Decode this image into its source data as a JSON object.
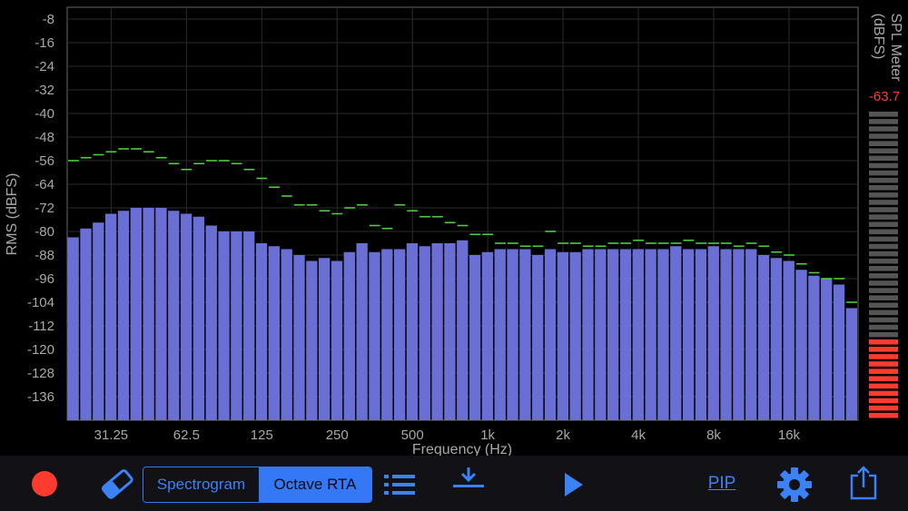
{
  "chart_data": {
    "type": "bar",
    "ylabel": "RMS (dBFS)",
    "xlabel": "Frequency (Hz)",
    "y_ticks": [
      "-8",
      "-16",
      "-24",
      "-32",
      "-40",
      "-48",
      "-56",
      "-64",
      "-72",
      "-80",
      "-88",
      "-96",
      "-104",
      "-112",
      "-120",
      "-128",
      "-136"
    ],
    "y_tick_values": [
      -8,
      -16,
      -24,
      -32,
      -40,
      -48,
      -56,
      -64,
      -72,
      -80,
      -88,
      -96,
      -104,
      -112,
      -120,
      -128,
      -136
    ],
    "x_ticks": [
      "31.25",
      "62.5",
      "125",
      "250",
      "500",
      "1k",
      "2k",
      "4k",
      "8k",
      "16k"
    ],
    "ylim": [
      -144,
      -4
    ],
    "grid": true,
    "series": [
      {
        "type": "bar",
        "color": "#6a6fd6",
        "values": [
          -82,
          -79,
          -77,
          -74,
          -73,
          -72,
          -72,
          -72,
          -73,
          -74,
          -75,
          -78,
          -80,
          -80,
          -80,
          -84,
          -85,
          -86,
          -88,
          -90,
          -89,
          -90,
          -87,
          -84,
          -87,
          -86,
          -86,
          -84,
          -85,
          -84,
          -84,
          -83,
          -88,
          -87,
          -86,
          -86,
          -86,
          -88,
          -86,
          -87,
          -87,
          -86,
          -86,
          -86,
          -86,
          -86,
          -86,
          -86,
          -85,
          -86,
          -86,
          -85,
          -86,
          -86,
          -86,
          -88,
          -89,
          -90,
          -93,
          -95,
          -96,
          -98,
          -106
        ]
      },
      {
        "type": "peak",
        "color": "#4ccd3b",
        "values": [
          -56,
          -55,
          -54,
          -53,
          -52,
          -52,
          -53,
          -55,
          -57,
          -59,
          -57,
          -56,
          -56,
          -57,
          -59,
          -62,
          -65,
          -68,
          -71,
          -71,
          -73,
          -74,
          -72,
          -71,
          -78,
          -79,
          -71,
          -73,
          -75,
          -75,
          -77,
          -78,
          -81,
          -81,
          -84,
          -84,
          -85,
          -85,
          -80,
          -84,
          -84,
          -85,
          -85,
          -84,
          -84,
          -83,
          -84,
          -84,
          -84,
          -83,
          -84,
          -84,
          -84,
          -85,
          -84,
          -85,
          -87,
          -88,
          -91,
          -94,
          -96,
          -96,
          -104
        ]
      }
    ]
  },
  "spl_meter": {
    "title": "SPL Meter",
    "unit": "(dBFS)",
    "value": "-63.7",
    "level_fraction": 0.27
  },
  "toolbar": {
    "record_icon": "record-icon",
    "eraser_icon": "eraser-icon",
    "segments": [
      "Spectrogram",
      "Octave RTA"
    ],
    "selected_segment": "Octave RTA",
    "list_icon": "list-icon",
    "download_icon": "download-icon",
    "play_icon": "play-icon",
    "pip_label": "PIP",
    "settings_icon": "gear-icon",
    "share_icon": "share-icon",
    "accent_color": "#3478f6",
    "record_color": "#ff3b30"
  }
}
